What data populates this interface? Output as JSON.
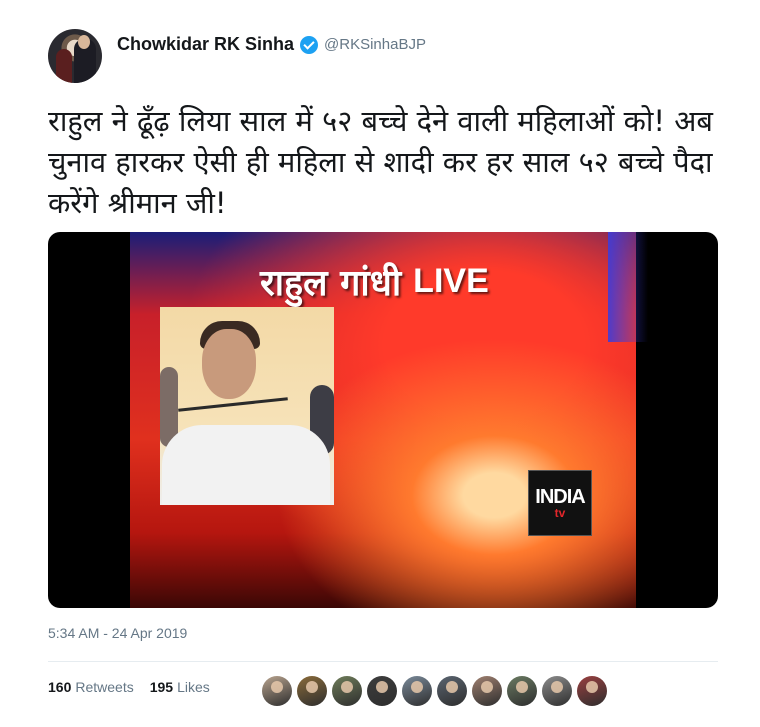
{
  "user": {
    "display_name": "Chowkidar RK Sinha",
    "handle": "@RKSinhaBJP",
    "verified_icon": "verified-badge-icon"
  },
  "tweet": {
    "text": "राहुल ने ढूँढ़ लिया साल में ५२ बच्चे देने वाली महिलाओं को! अब चुनाव हारकर ऐसी ही महिला से शादी कर हर साल ५२ बच्चे पैदा करेंगे श्रीमान जी!",
    "timestamp": "5:34 AM - 24 Apr 2019"
  },
  "media": {
    "banner_hindi": "राहुल गांधी",
    "banner_live": "LIVE",
    "logo_line1": "INDIA",
    "logo_line2": "tv"
  },
  "stats": {
    "retweets_count": "160",
    "retweets_label": "Retweets",
    "likes_count": "195",
    "likes_label": "Likes"
  },
  "likers": [
    {
      "name": "liker-avatar-1",
      "color": "#b9a48f"
    },
    {
      "name": "liker-avatar-2",
      "color": "#8a6b3a"
    },
    {
      "name": "liker-avatar-3",
      "color": "#6f7d5a"
    },
    {
      "name": "liker-avatar-4",
      "color": "#3d3d3d"
    },
    {
      "name": "liker-avatar-5",
      "color": "#7a8a9a"
    },
    {
      "name": "liker-avatar-6",
      "color": "#5a6470"
    },
    {
      "name": "liker-avatar-7",
      "color": "#a08070"
    },
    {
      "name": "liker-avatar-8",
      "color": "#6a7a62"
    },
    {
      "name": "liker-avatar-9",
      "color": "#8c8c8c"
    },
    {
      "name": "liker-avatar-10",
      "color": "#9a4040"
    }
  ],
  "colors": {
    "text": "#14171a",
    "secondary": "#657786",
    "accent": "#1da1f2",
    "divider": "#e6ecf0"
  }
}
